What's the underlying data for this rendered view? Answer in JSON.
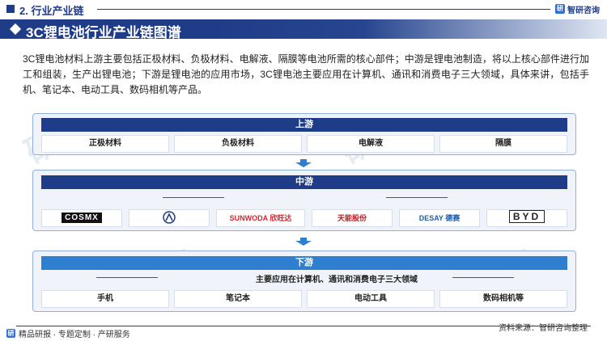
{
  "header": {
    "section_title": "2. 行业产业链",
    "logo_text": "智研咨询",
    "logo_mark": "研"
  },
  "title": "3C锂电池行业产业链图谱",
  "intro": "3C锂电池材料上游主要包括正极材料、负极材料、电解液、隔膜等电池所需的核心部件；中游是锂电池制造，将以上核心部件进行加工和组装，生产出锂电池；下游是锂电池的应用市场，3C锂电池主要应用在计算机、通讯和消费电子三大领域，具体来讲，包括手机、笔记本、电动工具、数码相机等产品。",
  "upstream": {
    "label": "上游",
    "items": [
      "正极材料",
      "负极材料",
      "电解液",
      "隔膜"
    ]
  },
  "midstream": {
    "label": "中游",
    "brands": [
      "COSMX",
      "ATL",
      "SUNWODA 欣旺达",
      "天能股份",
      "DESAY 德赛",
      "BYD"
    ]
  },
  "downstream": {
    "label": "下游",
    "subtitle": "主要应用在计算机、通讯和消费电子三大领域",
    "items": [
      "手机",
      "笔记本",
      "电动工具",
      "数码相机等"
    ]
  },
  "footer": {
    "left": "精品研报 · 专题定制 · 产研服务",
    "right": "资料来源：智研咨询整理"
  },
  "colors": {
    "primary": "#1f3c88",
    "accent": "#2f7fd0",
    "panel": "#f0f4fa"
  }
}
